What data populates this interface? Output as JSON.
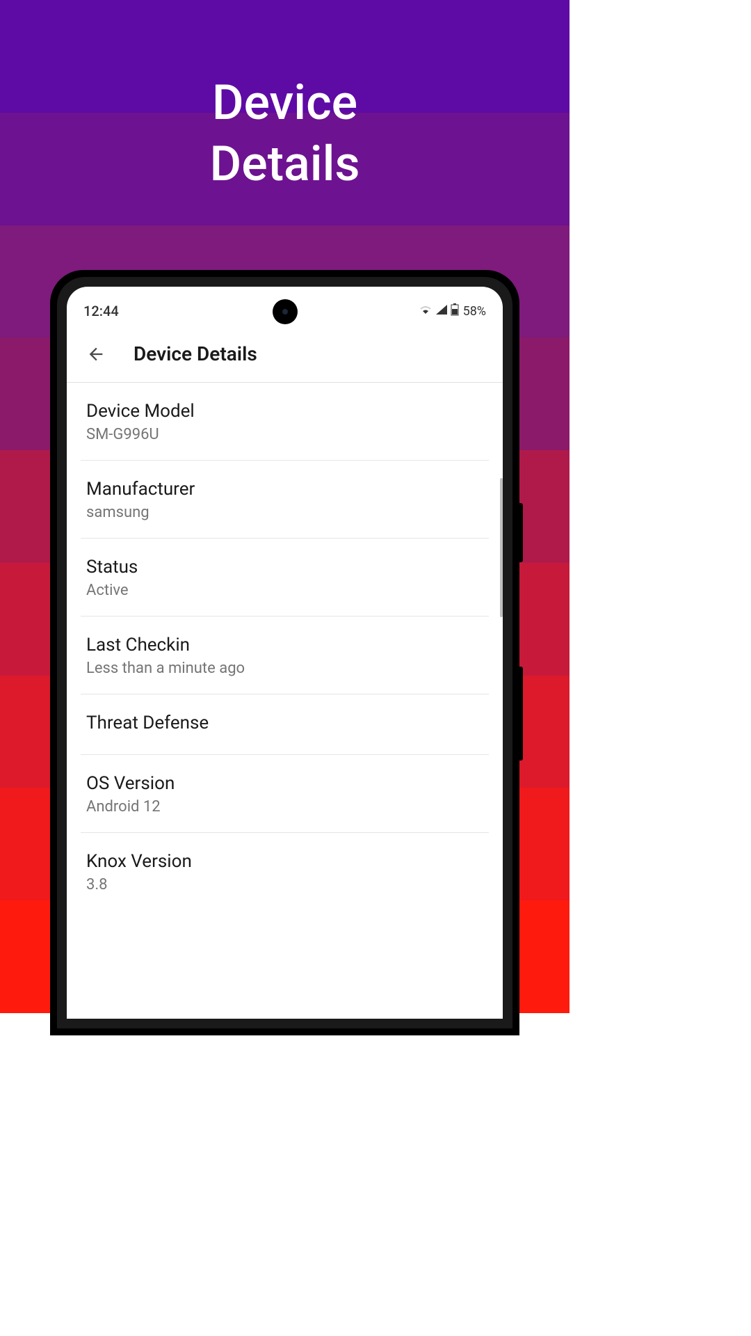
{
  "page": {
    "title_line1": "Device",
    "title_line2": "Details"
  },
  "statusbar": {
    "time": "12:44",
    "battery": "58%"
  },
  "header": {
    "title": "Device Details"
  },
  "details": [
    {
      "label": "Device Model",
      "value": "SM-G996U"
    },
    {
      "label": "Manufacturer",
      "value": "samsung"
    },
    {
      "label": "Status",
      "value": "Active"
    },
    {
      "label": "Last Checkin",
      "value": "Less than a minute ago"
    },
    {
      "label": "Threat Defense",
      "value": ""
    },
    {
      "label": "OS Version",
      "value": "Android 12"
    },
    {
      "label": "Knox Version",
      "value": "3.8"
    }
  ]
}
